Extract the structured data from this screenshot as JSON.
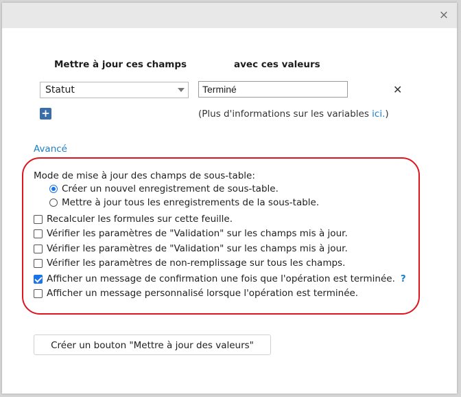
{
  "dialog": {
    "close_icon": "×"
  },
  "fields": {
    "header_fields": "Mettre à jour ces champs",
    "header_values": "avec ces valeurs",
    "field_select": "Statut",
    "value_input": "Terminé",
    "remove_icon": "✕",
    "add_icon": "+",
    "vars_note_prefix": "(Plus d'informations sur les variables ",
    "vars_note_link": "ici.",
    "vars_note_suffix": ")"
  },
  "advanced": {
    "label": "Avancé",
    "mode_title": "Mode de mise à jour des champs de sous-table:",
    "radio_options": [
      {
        "label": "Créer un nouvel enregistrement de sous-table.",
        "selected": true
      },
      {
        "label": "Mettre à jour tous les enregistrements de la sous-table.",
        "selected": false
      }
    ],
    "checkboxes": [
      {
        "label": "Recalculer les formules sur cette feuille.",
        "checked": false
      },
      {
        "label": "Vérifier les paramètres de \"Validation\" sur les champs mis à jour.",
        "checked": false
      },
      {
        "label": "Vérifier les paramètres de \"Validation\" sur les champs mis à jour.",
        "checked": false
      },
      {
        "label": "Vérifier les paramètres de non-remplissage sur tous les champs.",
        "checked": false
      },
      {
        "label": "Afficher un message de confirmation une fois que l'opération est terminée.",
        "checked": true
      },
      {
        "label": "Afficher un message personnalisé lorsque l'opération est terminée.",
        "checked": false
      }
    ],
    "help_icon": "?"
  },
  "actions": {
    "create_button": "Créer un bouton \"Mettre à jour des valeurs\""
  },
  "colors": {
    "accent": "#1a73e8",
    "link": "#1e7ec8",
    "highlight_outline": "#e0141e",
    "add_button": "#3a6ea8"
  }
}
